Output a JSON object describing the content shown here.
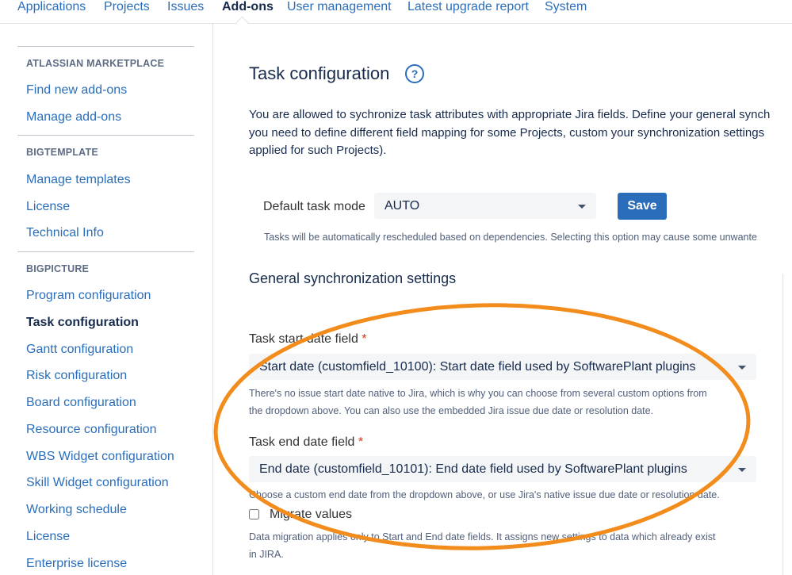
{
  "topnav": {
    "tabs": [
      {
        "label": "Applications"
      },
      {
        "label": "Projects"
      },
      {
        "label": "Issues"
      },
      {
        "label": "Add-ons",
        "active": true
      },
      {
        "label": "User management"
      },
      {
        "label": "Latest upgrade report"
      },
      {
        "label": "System"
      }
    ]
  },
  "sidebar": {
    "sections": [
      {
        "heading": "ATLASSIAN MARKETPLACE",
        "items": [
          "Find new add-ons",
          "Manage add-ons"
        ]
      },
      {
        "heading": "BIGTEMPLATE",
        "items": [
          "Manage templates",
          "License",
          "Technical Info"
        ]
      },
      {
        "heading": "BIGPICTURE",
        "items": [
          "Program configuration",
          "Task configuration",
          "Gantt configuration",
          "Risk configuration",
          "Board configuration",
          "Resource configuration",
          "WBS Widget configuration",
          "Skill Widget configuration",
          "Working schedule",
          "License",
          "Enterprise license"
        ]
      }
    ],
    "active_item": "Task configuration"
  },
  "main": {
    "title": "Task configuration",
    "help_icon": "question-circle-icon",
    "intro_lines": [
      "You are allowed to sychronize task attributes with appropriate Jira fields. Define your general synch",
      "you need to define different field mapping for some Projects, custom your synchronization settings",
      "applied for such Projects)."
    ],
    "task_mode": {
      "label": "Default task mode",
      "value": "AUTO",
      "save_label": "Save",
      "help": "Tasks will be automatically rescheduled based on dependencies. Selecting this option may cause some unwante"
    },
    "sync_title": "General synchronization settings",
    "start_field": {
      "label": "Task start date field",
      "required_mark": "*",
      "value": "Start date (customfield_10100): Start date field used by SoftwarePlant plugins",
      "help_lines": [
        "There's no issue start date native to Jira, which is why you can choose from several custom options from",
        "the dropdown above. You can also use the embedded Jira issue due date or resolution date."
      ]
    },
    "end_field": {
      "label": "Task end date field",
      "required_mark": "*",
      "value": "End date (customfield_10101): End date field used by SoftwarePlant plugins",
      "help": "Choose a custom end date from the dropdown above, or use Jira's native issue due date or resolution date."
    },
    "migrate": {
      "label": "Migrate values",
      "checked": false,
      "help_lines": [
        "Data migration applies only to Start and End date fields. It assigns new settings to data which already exist",
        "in JIRA."
      ]
    }
  },
  "colors": {
    "link": "#2a6ebb",
    "button": "#2a6ebb",
    "required": "#de350b",
    "annotation_ellipse": "#f28c1c"
  }
}
